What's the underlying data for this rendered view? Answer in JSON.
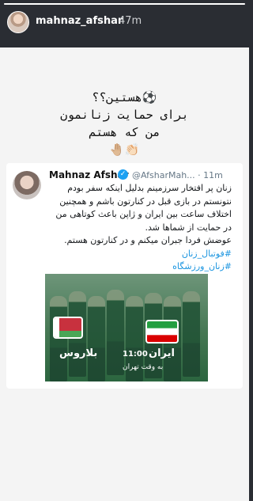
{
  "story": {
    "progress": 1.0
  },
  "header": {
    "username": "mahnaz_afshar",
    "time": "47m"
  },
  "headline": {
    "line1": "هستین؟؟⚽",
    "line2": "برای حمایت زنانمون",
    "line3": "من که هستم",
    "emojis": "🤚🏼👏🏻"
  },
  "tweet": {
    "name": "Mahnaz Afshar",
    "handle": "@AfsharMah...",
    "time": "· 11m",
    "lines": [
      "زنان پر افتخار سرزمینم بدلیل اینکه سفر بودم",
      "نتونستم در بازی قبل در کنارتون باشم و همچنین",
      "اختلاف ساعت بین ایران و ژاپن باعث کوتاهی من",
      "در حمایت از شماها شد.",
      "عوضش فردا جبران میکنم و در کنارتون هستم."
    ],
    "hashtags": [
      "#فوتبال_زنان",
      "#زنان_ورزشگاه"
    ]
  },
  "media": {
    "team_left": "بلاروس",
    "team_right": "ایران",
    "kickoff_time": "11:00",
    "kickoff_note": "به وقت تهران"
  }
}
